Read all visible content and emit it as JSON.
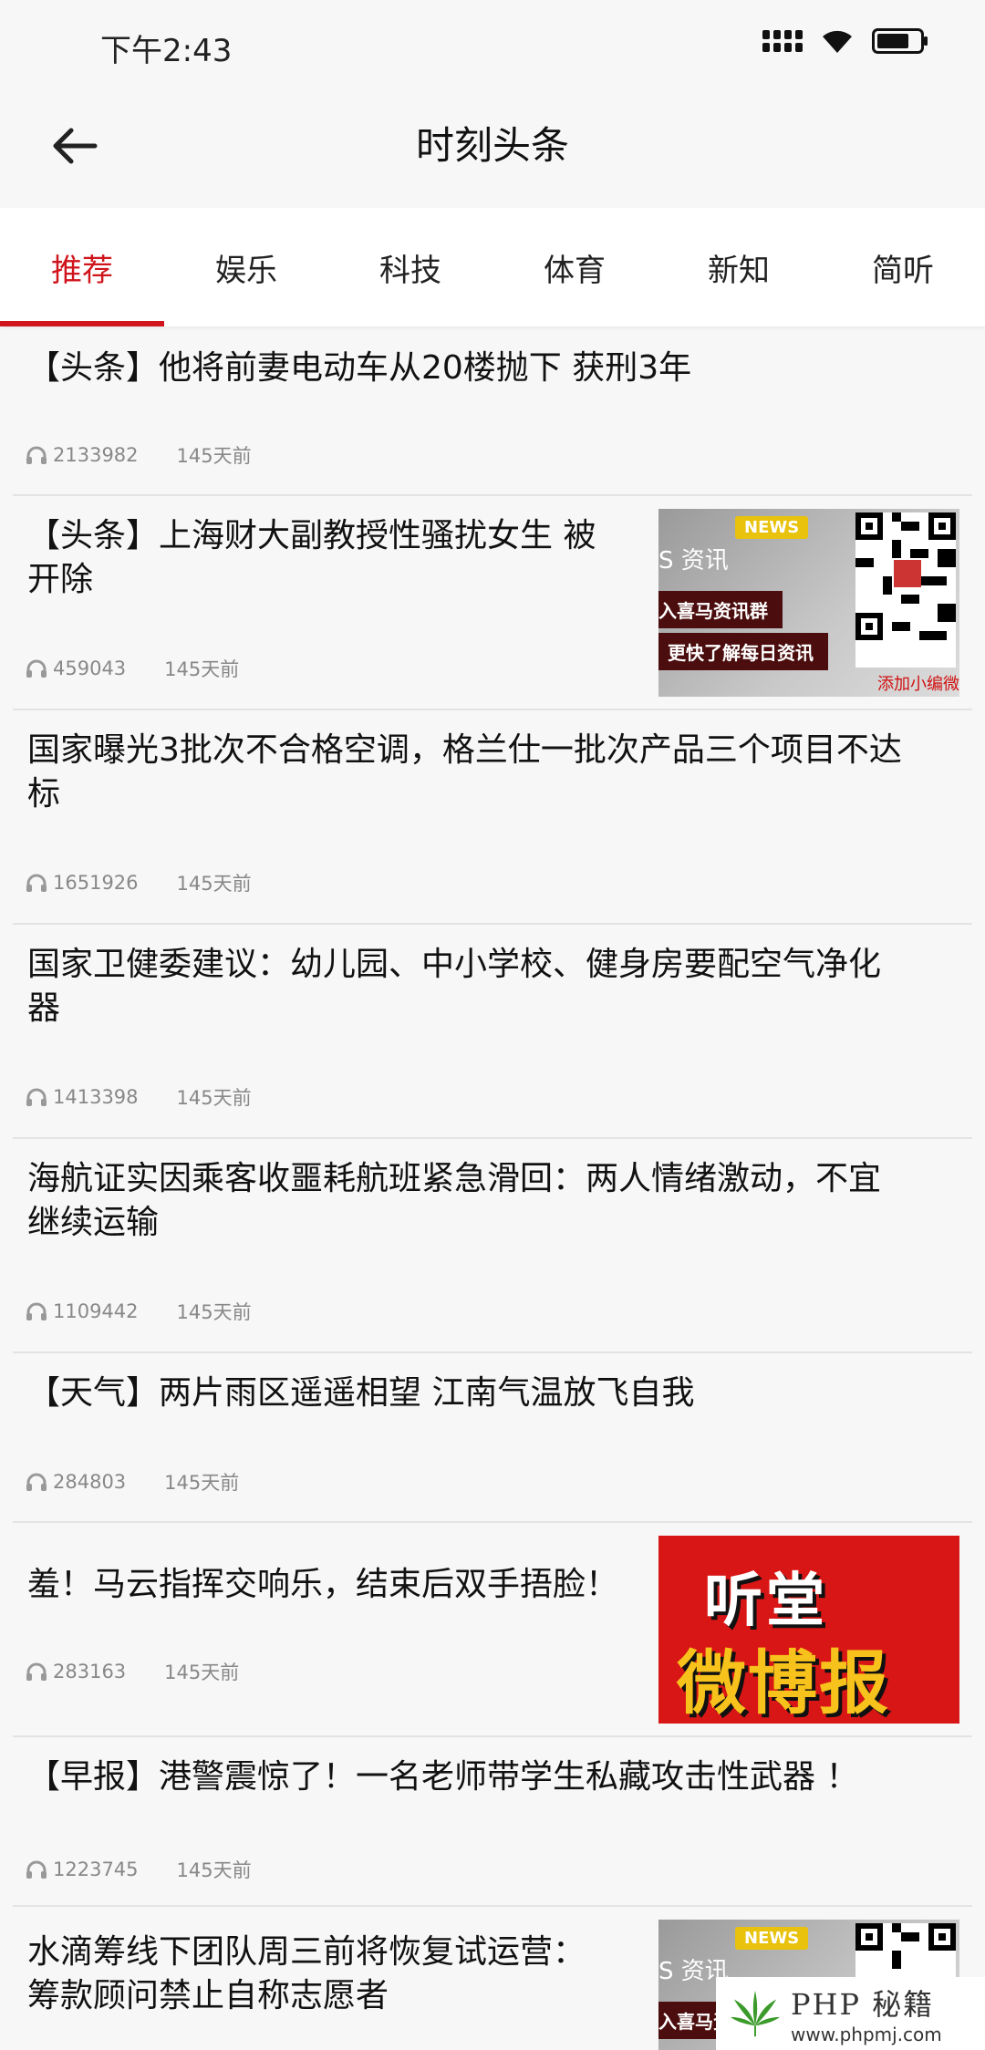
{
  "status_bar": {
    "time": "下午2:43"
  },
  "header": {
    "title": "时刻头条"
  },
  "tabs": [
    {
      "label": "推荐",
      "active": true
    },
    {
      "label": "娱乐",
      "active": false
    },
    {
      "label": "科技",
      "active": false
    },
    {
      "label": "体育",
      "active": false
    },
    {
      "label": "新知",
      "active": false
    },
    {
      "label": "简听",
      "active": false
    }
  ],
  "feed": [
    {
      "title_line1": "【头条】他将前妻电动车从20楼抛下 获刑3年",
      "title_line2": "",
      "plays": "2133982",
      "age": "145天前",
      "thumb": "none"
    },
    {
      "title_line1": "【头条】上海财大副教授性骚扰女生 被",
      "title_line2": "开除",
      "plays": "459043",
      "age": "145天前",
      "thumb": "qr"
    },
    {
      "title_line1": "国家曝光3批次不合格空调，格兰仕一批次产品三个项目不达",
      "title_line2": "标",
      "plays": "1651926",
      "age": "145天前",
      "thumb": "none"
    },
    {
      "title_line1": "国家卫健委建议：幼儿园、中小学校、健身房要配空气净化",
      "title_line2": "器",
      "plays": "1413398",
      "age": "145天前",
      "thumb": "none"
    },
    {
      "title_line1": "海航证实因乘客收噩耗航班紧急滑回：两人情绪激动，不宜",
      "title_line2": "继续运输",
      "plays": "1109442",
      "age": "145天前",
      "thumb": "none"
    },
    {
      "title_line1": "【天气】两片雨区遥遥相望 江南气温放飞自我",
      "title_line2": "",
      "plays": "284803",
      "age": "145天前",
      "thumb": "none"
    },
    {
      "title_line1": "羞！马云指挥交响乐，结束后双手捂脸！",
      "title_line2": "",
      "plays": "283163",
      "age": "145天前",
      "thumb": "poster"
    },
    {
      "title_line1": "【早报】港警震惊了！一名老师带学生私藏攻击性武器 ！",
      "title_line2": "",
      "plays": "1223745",
      "age": "145天前",
      "thumb": "none"
    },
    {
      "title_line1": "水滴筹线下团队周三前将恢复试运营：",
      "title_line2": "筹款顾问禁止自称志愿者",
      "plays": "",
      "age": "",
      "thumb": "qr"
    }
  ],
  "thumb_qr": {
    "badge": "NEWS",
    "brand": "S 资讯",
    "line1": "入喜马资讯群",
    "line2": "更快了解每日资讯",
    "footer": "添加小编微"
  },
  "thumb_poster": {
    "top": "听堂",
    "bottom": "微博报"
  },
  "watermark": {
    "title": "PHP 秘籍",
    "url": "www.phpmj.com"
  },
  "colors": {
    "accent": "#d0141c",
    "background": "#f7f7f7",
    "meta_text": "#888888"
  }
}
